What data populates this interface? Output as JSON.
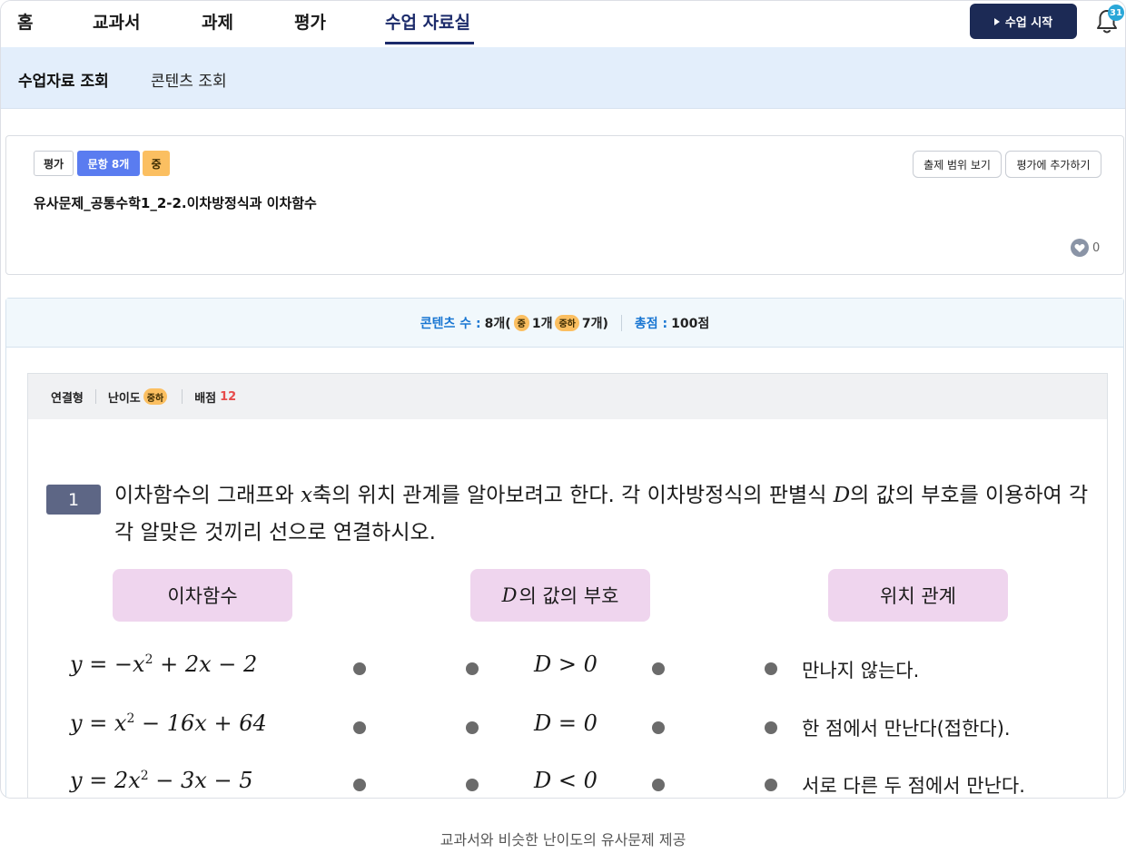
{
  "nav": {
    "tabs": [
      "홈",
      "교과서",
      "과제",
      "평가",
      "수업 자료실"
    ],
    "active": "수업 자료실",
    "start_button": "수업 시작",
    "notification_count": "31"
  },
  "subnav": {
    "items": [
      "수업자료 조회",
      "콘텐츠 조회"
    ],
    "active": "수업자료 조회"
  },
  "card": {
    "tag_type": "평가",
    "tag_count": "문항 8개",
    "tag_level": "중",
    "btn_scope": "출제 범위 보기",
    "btn_add": "평가에 추가하기",
    "title": "유사문제_공통수학1_2-2.이차방정식과 이차함수",
    "likes": "0"
  },
  "summary": {
    "content_label": "콘텐츠 수 :",
    "content_count": "8개(",
    "level_mid": "중",
    "mid_count": "1개",
    "level_midlow": "중하",
    "midlow_count": "7개)",
    "score_label": "총점 :",
    "score_value": "100점"
  },
  "question": {
    "type": "연결형",
    "difficulty_label": "난이도",
    "difficulty": "중하",
    "points_label": "배점",
    "points": "12",
    "number": "1",
    "text_1": "이차함수의 그래프와 ",
    "var_x": "x",
    "text_2": "축의 위치 관계를 알아보려고 한다. 각 이차방정식의 판별식 ",
    "var_D": "D",
    "text_3": "의 값의 부호를 이용하여 각각 알맞은 것끼리 선으로 연결하시오.",
    "col_headers": {
      "func": "이차함수",
      "d_sign": "의 값의 부호",
      "relation": "위치 관계"
    },
    "functions": [
      "y = −x",
      "2",
      " + 2x − 2",
      "y = x",
      "2",
      " − 16x + 64",
      "y = 2x",
      "2",
      " − 3x − 5"
    ],
    "d_values": [
      "D > 0",
      "D = 0",
      "D < 0"
    ],
    "relations": [
      "만나지 않는다.",
      "한 점에서 만난다(접한다).",
      "서로 다른 두 점에서 만난다."
    ]
  },
  "caption": "교과서와 비슷한 난이도의 유사문제 제공",
  "colors": {
    "nav_active": "#1c2b6b",
    "start_btn": "#1c2a55",
    "subnav_bg": "#e3eefb",
    "count_tag": "#5a7cf0",
    "level_tag": "#fbbf61",
    "col_box": "#efd5ee",
    "points_red": "#e74b4b",
    "summary_blue": "#1976d2"
  }
}
